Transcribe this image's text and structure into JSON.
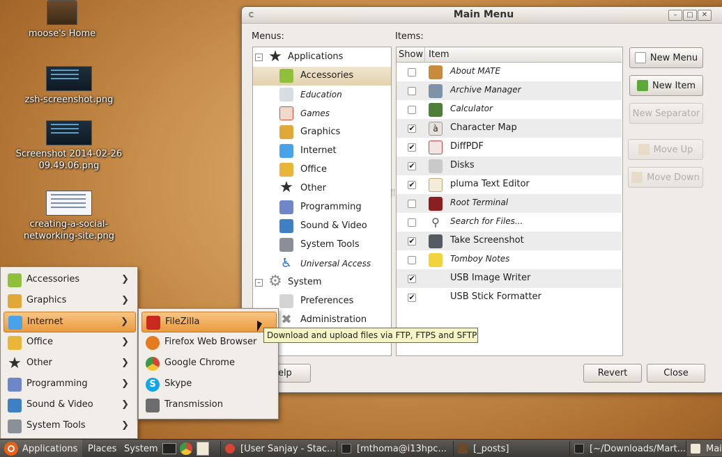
{
  "desktop": {
    "icons": [
      {
        "label": "moose's Home"
      },
      {
        "label": "zsh-screenshot.png"
      },
      {
        "label": "Screenshot 2014-02-26 09.49.06.png"
      },
      {
        "label": "creating-a-social-networking-site.png"
      }
    ]
  },
  "window": {
    "title": "Main Menu",
    "menus_label": "Menus:",
    "items_label": "Items:",
    "tree": [
      {
        "label": "Applications",
        "icon": "star-icon",
        "color": "#2f2f2f"
      },
      {
        "label": "Accessories",
        "icon": "accessories-icon",
        "color": "#8fbf3b"
      },
      {
        "label": "Education",
        "icon": "flask-icon",
        "color": "#9ea6b0"
      },
      {
        "label": "Games",
        "icon": "cards-icon",
        "color": "#d94c3a"
      },
      {
        "label": "Graphics",
        "icon": "graphics-icon",
        "color": "#e0a838"
      },
      {
        "label": "Internet",
        "icon": "internet-icon",
        "color": "#4aa3e8"
      },
      {
        "label": "Office",
        "icon": "office-icon",
        "color": "#e8b73a"
      },
      {
        "label": "Other",
        "icon": "star-icon",
        "color": "#2f2f2f"
      },
      {
        "label": "Programming",
        "icon": "programming-icon",
        "color": "#6f87c9"
      },
      {
        "label": "Sound & Video",
        "icon": "media-icon",
        "color": "#3f7fc4"
      },
      {
        "label": "System Tools",
        "icon": "tools-icon",
        "color": "#8a9097"
      },
      {
        "label": "Universal Access",
        "icon": "accessibility-icon",
        "color": "#2d6bbf"
      },
      {
        "label": "System",
        "icon": "gear-icon",
        "color": "#9a9a9a"
      },
      {
        "label": "Preferences",
        "icon": "preferences-icon",
        "color": "#c0c0c0"
      },
      {
        "label": "Administration",
        "icon": "wrench-icon",
        "color": "#9a9a9a"
      }
    ],
    "list_header": {
      "show": "Show",
      "item": "Item"
    },
    "items": [
      {
        "label": "About MATE",
        "checked": false,
        "icon": "about-icon",
        "color": "#c98a3d"
      },
      {
        "label": "Archive Manager",
        "checked": false,
        "icon": "archive-icon",
        "color": "#7f93a8"
      },
      {
        "label": "Calculator",
        "checked": false,
        "icon": "calculator-icon",
        "color": "#4f7d3a"
      },
      {
        "label": "Character Map",
        "checked": true,
        "icon": "charmap-icon",
        "color": "#d7d3cc"
      },
      {
        "label": "DiffPDF",
        "checked": true,
        "icon": "pdf-icon",
        "color": "#c04a4a"
      },
      {
        "label": "Disks",
        "checked": true,
        "icon": "disk-icon",
        "color": "#b9b9b9"
      },
      {
        "label": "pluma Text Editor",
        "checked": true,
        "icon": "text-editor-icon",
        "color": "#e8e0c8"
      },
      {
        "label": "Root Terminal",
        "checked": false,
        "icon": "terminal-icon",
        "color": "#8b1e1e"
      },
      {
        "label": "Search for Files...",
        "checked": false,
        "icon": "search-icon",
        "color": "#cfcfcf"
      },
      {
        "label": "Take Screenshot",
        "checked": true,
        "icon": "camera-icon",
        "color": "#555a63"
      },
      {
        "label": "Tomboy Notes",
        "checked": false,
        "icon": "note-icon",
        "color": "#f1d43c"
      },
      {
        "label": "USB Image Writer",
        "checked": true,
        "icon": "",
        "color": ""
      },
      {
        "label": "USB Stick Formatter",
        "checked": true,
        "icon": "",
        "color": ""
      }
    ],
    "buttons": {
      "new_menu": "New Menu",
      "new_item": "New Item",
      "new_separator": "New Separator",
      "move_up": "Move Up",
      "move_down": "Move Down",
      "help": "Help",
      "revert": "Revert",
      "close": "Close"
    }
  },
  "apps_menu": [
    {
      "label": "Accessories",
      "icon": "accessories-icon",
      "color": "#8fbf3b"
    },
    {
      "label": "Graphics",
      "icon": "graphics-icon",
      "color": "#e0a838"
    },
    {
      "label": "Internet",
      "icon": "internet-icon",
      "color": "#4aa3e8"
    },
    {
      "label": "Office",
      "icon": "office-icon",
      "color": "#e8b73a"
    },
    {
      "label": "Other",
      "icon": "star-icon",
      "color": "#2f2f2f"
    },
    {
      "label": "Programming",
      "icon": "programming-icon",
      "color": "#6f87c9"
    },
    {
      "label": "Sound & Video",
      "icon": "media-icon",
      "color": "#3f7fc4"
    },
    {
      "label": "System Tools",
      "icon": "tools-icon",
      "color": "#8a9097"
    }
  ],
  "internet_menu": [
    {
      "label": "FileZilla",
      "icon": "filezilla-icon",
      "color": "#c8281e"
    },
    {
      "label": "Firefox Web Browser",
      "icon": "firefox-icon",
      "color": "#e57a1e"
    },
    {
      "label": "Google Chrome",
      "icon": "chrome-icon",
      "color": "#3a9a45"
    },
    {
      "label": "Skype",
      "icon": "skype-icon",
      "color": "#13a6e6"
    },
    {
      "label": "Transmission",
      "icon": "transmission-icon",
      "color": "#6d6d6d"
    }
  ],
  "tooltip": "Download and upload files via FTP, FTPS and SFTP",
  "panel": {
    "applications": "Applications",
    "places": "Places",
    "system": "System",
    "tasks": [
      "[User Sanjay - Stac...",
      "[mthoma@i13hpc...",
      "[_posts]",
      "[~/Downloads/Mart...",
      "Mai"
    ]
  },
  "colors": {
    "highlight": "#ea9a3e",
    "panel": "#3c3a36",
    "window_bg": "#efebe7"
  }
}
